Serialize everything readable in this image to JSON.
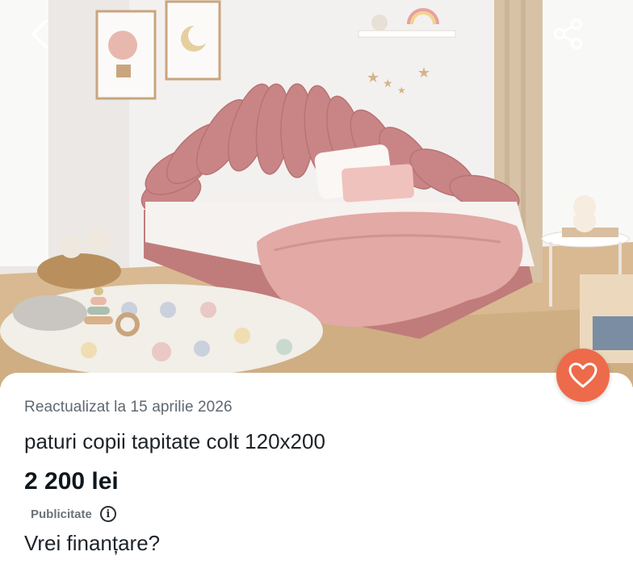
{
  "photo": {
    "alt": "paturi copii tapitate colt 120x200",
    "colors": {
      "wall": "#f3f1ef",
      "floor": "#d9b991",
      "headboard": "#c98585",
      "blanket": "#e2a9a5",
      "curtain": "#d7c2a6"
    }
  },
  "nav": {
    "back_icon": "chevron-left-icon",
    "share_icon": "share-icon"
  },
  "favorite": {
    "icon": "heart-icon",
    "color": "#ed6a4a"
  },
  "listing": {
    "updated": "Reactualizat la 15 aprilie 2026",
    "title": "paturi copii tapitate colt 120x200",
    "price": "2 200 lei",
    "ad_label": "Publicitate",
    "ad_info_icon": "info-icon",
    "financing_prompt": "Vrei finanțare?"
  }
}
